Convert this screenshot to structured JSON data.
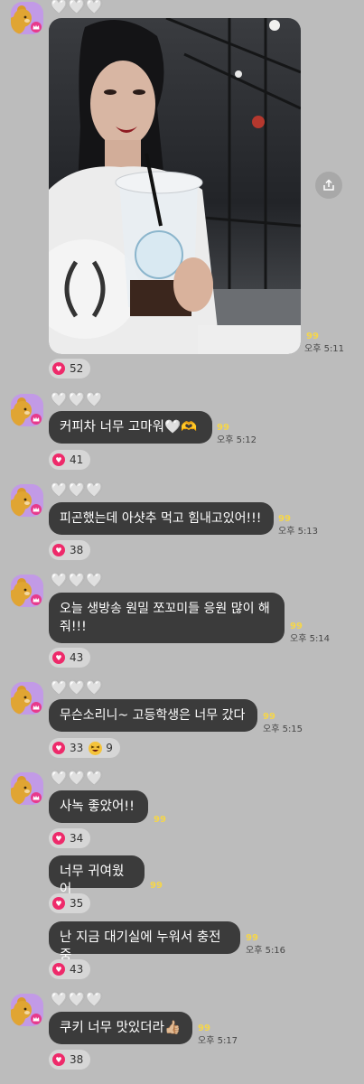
{
  "sender": {
    "name": "🤍🤍🤍"
  },
  "messages": [
    {
      "unread": "99",
      "time": "오후 5:11",
      "reaction_count": "52"
    },
    {
      "text": "커피차 너무 고마워🤍🫶",
      "unread": "99",
      "time": "오후 5:12",
      "reaction_count": "41"
    },
    {
      "text": "피곤했는데 아샷추 먹고 힘내고있어!!!",
      "unread": "99",
      "time": "오후 5:13",
      "reaction_count": "38"
    },
    {
      "text_line1": "오늘 생방송 원밀 쪼꼬미들 응원 많이 해",
      "text_line2": "줘!!!",
      "unread": "99",
      "time": "오후 5:14",
      "reaction_count": "43"
    },
    {
      "text": "무슨소리니~ 고등학생은 너무 갔다",
      "unread": "99",
      "time": "오후 5:15",
      "reaction_count": "33",
      "reaction2_count": "9"
    },
    {
      "text": "사녹 좋았어!!",
      "unread": "99",
      "reaction_count": "34"
    },
    {
      "text": "너무 귀여웠어",
      "unread": "99",
      "reaction_count": "35"
    },
    {
      "text": "난 지금 대기실에 누워서 충전중",
      "unread": "99",
      "time": "오후 5:16",
      "reaction_count": "43"
    },
    {
      "text": "쿠키 너무 맛있더라👍🏼",
      "unread": "99",
      "time": "오후 5:17",
      "reaction_count": "38"
    }
  ],
  "icons": {
    "avatar": "bear-avatar-icon",
    "crown": "crown-badge-icon",
    "heart": "heart-icon",
    "share": "share-icon",
    "laugh": "laughing-face-icon"
  },
  "colors": {
    "background": "#bcbcbc",
    "bubble": "#3b3b3b",
    "unread": "#f5d64a",
    "heart": "#ee2a6a",
    "avatar": "#c29ae6"
  }
}
